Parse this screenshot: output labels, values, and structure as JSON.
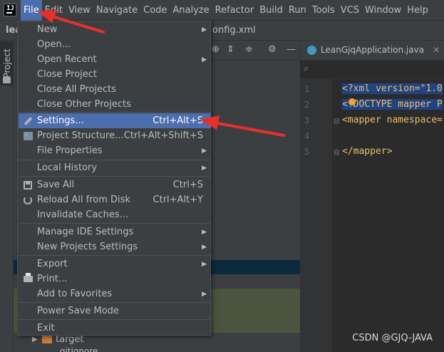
{
  "menubar": {
    "items": [
      "File",
      "Edit",
      "View",
      "Navigate",
      "Code",
      "Analyze",
      "Refactor",
      "Build",
      "Run",
      "Tools",
      "VCS",
      "Window",
      "Help"
    ]
  },
  "toolbar": {
    "project_name": "lea",
    "breadcrumb_file": "onfig.xml"
  },
  "tool_window": {
    "project_tab_label": "Project"
  },
  "file_menu": {
    "items": [
      {
        "label": "New",
        "shortcut": "",
        "submenu": true,
        "icon": ""
      },
      {
        "label": "Open...",
        "shortcut": "",
        "submenu": false,
        "icon": ""
      },
      {
        "label": "Open Recent",
        "shortcut": "",
        "submenu": true,
        "icon": ""
      },
      {
        "label": "Close Project",
        "shortcut": "",
        "submenu": false,
        "icon": ""
      },
      {
        "label": "Close All Projects",
        "shortcut": "",
        "submenu": false,
        "icon": ""
      },
      {
        "label": "Close Other Projects",
        "shortcut": "",
        "submenu": false,
        "icon": ""
      },
      {
        "label": "Settings...",
        "shortcut": "Ctrl+Alt+S",
        "submenu": false,
        "icon": "wrench-icon",
        "highlighted": true
      },
      {
        "label": "Project Structure...",
        "shortcut": "Ctrl+Alt+Shift+S",
        "submenu": false,
        "icon": "project-structure-icon"
      },
      {
        "label": "File Properties",
        "shortcut": "",
        "submenu": true,
        "icon": ""
      },
      {
        "label": "Local History",
        "shortcut": "",
        "submenu": true,
        "icon": ""
      },
      {
        "label": "Save All",
        "shortcut": "Ctrl+S",
        "submenu": false,
        "icon": "save-icon"
      },
      {
        "label": "Reload All from Disk",
        "shortcut": "Ctrl+Alt+Y",
        "submenu": false,
        "icon": "reload-icon"
      },
      {
        "label": "Invalidate Caches...",
        "shortcut": "",
        "submenu": false,
        "icon": ""
      },
      {
        "label": "Manage IDE Settings",
        "shortcut": "",
        "submenu": true,
        "icon": ""
      },
      {
        "label": "New Projects Settings",
        "shortcut": "",
        "submenu": true,
        "icon": ""
      },
      {
        "label": "Export",
        "shortcut": "",
        "submenu": true,
        "icon": ""
      },
      {
        "label": "Print...",
        "shortcut": "",
        "submenu": false,
        "icon": "print-icon"
      },
      {
        "label": "Add to Favorites",
        "shortcut": "",
        "submenu": true,
        "icon": ""
      },
      {
        "label": "Power Save Mode",
        "shortcut": "",
        "submenu": false,
        "icon": ""
      },
      {
        "label": "Exit",
        "shortcut": "",
        "submenu": false,
        "icon": ""
      }
    ]
  },
  "editor": {
    "tab_label": "LeanGjqApplication.java",
    "line_numbers": [
      "1",
      "2",
      "3",
      "4",
      "5"
    ],
    "lines": [
      {
        "text": "<?xml version=\"1.0",
        "selected": true
      },
      {
        "text": "<!DOCTYPE mapper P",
        "selected": true
      },
      {
        "text": "<mapper namespace=",
        "selected": false
      },
      {
        "text": "",
        "selected": false
      },
      {
        "text": "</mapper>",
        "selected": false
      }
    ]
  },
  "project_tree": {
    "folder_label": "target",
    "next_label": ".gitignore"
  },
  "watermark": "CSDN @GJQ-JAVA",
  "colors": {
    "accent": "#4b6eaf",
    "annotation_arrow": "#e8302a"
  }
}
